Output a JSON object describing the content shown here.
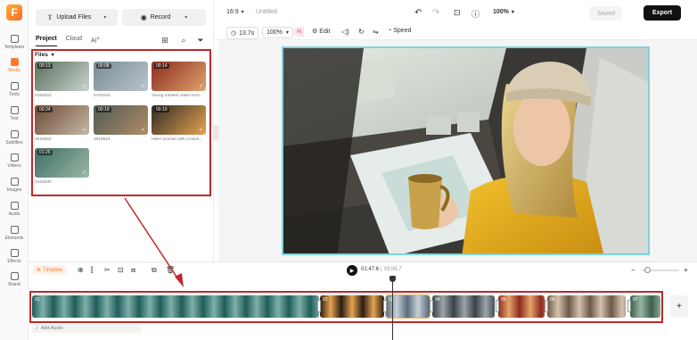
{
  "rail": {
    "logo": "F",
    "items": [
      {
        "label": "Templates",
        "icon": "templates-icon"
      },
      {
        "label": "Media",
        "icon": "media-icon",
        "active": true
      },
      {
        "label": "Tools",
        "icon": "ai-tools-icon"
      },
      {
        "label": "Text",
        "icon": "text-icon"
      },
      {
        "label": "Subtitles",
        "icon": "subtitles-icon"
      },
      {
        "label": "Videos",
        "icon": "videos-icon"
      },
      {
        "label": "Images",
        "icon": "images-icon"
      },
      {
        "label": "Audio",
        "icon": "audio-icon"
      },
      {
        "label": "Elements",
        "icon": "elements-icon"
      },
      {
        "label": "Effects",
        "icon": "effects-icon"
      },
      {
        "label": "Brand",
        "icon": "brand-icon"
      }
    ]
  },
  "panel": {
    "upload_label": "Upload Files",
    "record_label": "Record",
    "tabs": {
      "project": "Project",
      "cloud": "Cloud",
      "ai": "AI"
    },
    "files_label": "Files",
    "media": [
      {
        "duration": "00:13",
        "caption": "2152022",
        "colors": [
          "#5a6e5a",
          "#c9d2cf"
        ]
      },
      {
        "duration": "00:08",
        "caption": "5763242",
        "colors": [
          "#7a8b96",
          "#b9c4cc"
        ]
      },
      {
        "duration": "00:14",
        "caption": "Young traveler waits from...",
        "colors": [
          "#8a2b1f",
          "#e0a36b"
        ]
      },
      {
        "duration": "00:24",
        "caption": "3018664",
        "colors": [
          "#6b4a35",
          "#c7b7a6"
        ]
      },
      {
        "duration": "00:19",
        "caption": "3015510",
        "colors": [
          "#4e5b55",
          "#b38b66"
        ]
      },
      {
        "duration": "00:19",
        "caption": "Hiker woman with a back...",
        "colors": [
          "#2f2a25",
          "#e6a350"
        ]
      },
      {
        "duration": "01:25",
        "caption": "2164830",
        "colors": [
          "#3f6e66",
          "#9bb8a5"
        ]
      }
    ]
  },
  "topbar": {
    "aspect": "16:9",
    "title": "Untitled",
    "zoom": "100%",
    "saved_label": "Saved",
    "export_label": "Export"
  },
  "subbar": {
    "duration": "13.7s",
    "scale": "100%",
    "edit_label": "Edit",
    "speed_label": "Speed"
  },
  "timeline": {
    "label": "Timeline",
    "current_time": "01:47.6",
    "total_time": "03:06.7",
    "add_audio_label": "Add Audio",
    "clips": [
      {
        "label": "01",
        "colors": [
          "#1f5c5a",
          "#7fb0a8"
        ]
      },
      {
        "label": "02",
        "colors": [
          "#2a1c14",
          "#e6a44e"
        ]
      },
      {
        "label": "03",
        "colors": [
          "#5b6d7d",
          "#c7d0d4"
        ]
      },
      {
        "label": "04",
        "colors": [
          "#3a4148",
          "#9ba4a9"
        ]
      },
      {
        "label": "05",
        "colors": [
          "#8c2a21",
          "#e5a46a"
        ]
      },
      {
        "label": "06",
        "colors": [
          "#6e5747",
          "#d4c2ae"
        ]
      },
      {
        "label": "07",
        "colors": [
          "#3c5e4b",
          "#98b6a4"
        ]
      }
    ]
  }
}
